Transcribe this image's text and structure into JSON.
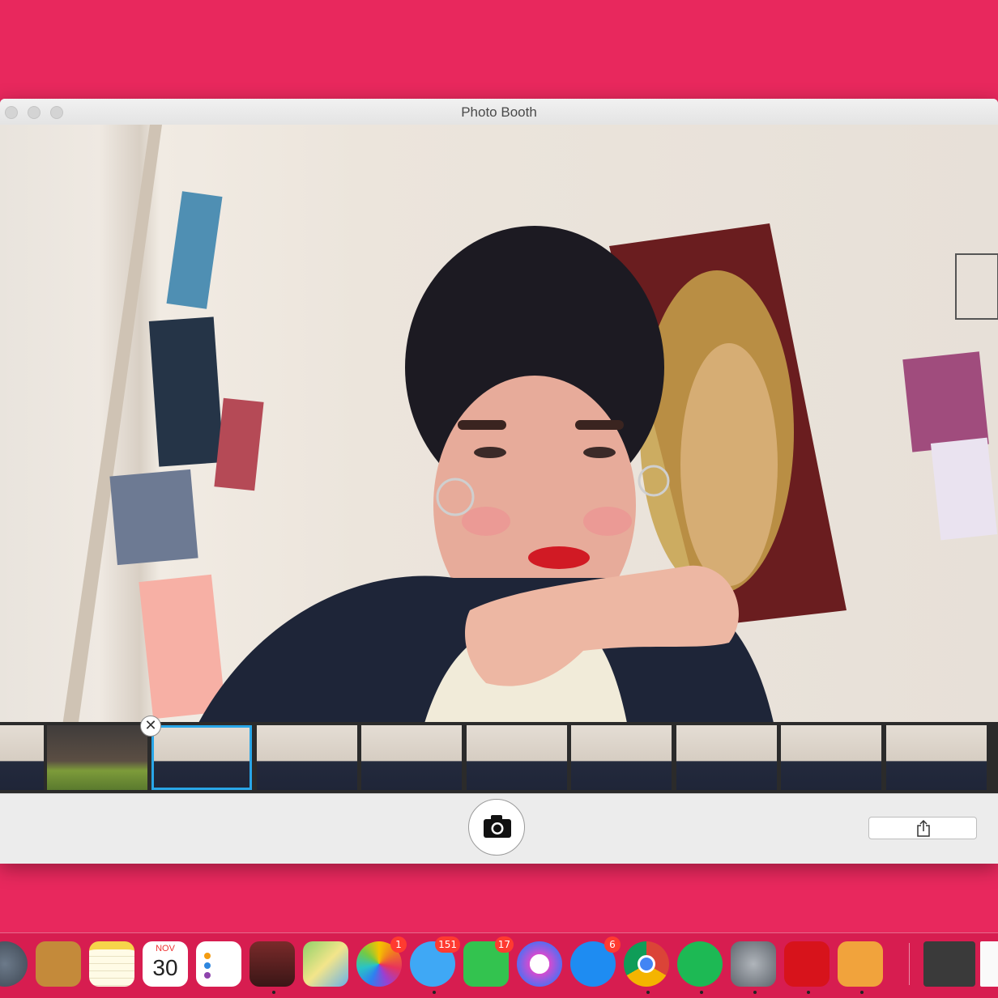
{
  "window": {
    "title": "Photo Booth"
  },
  "calendar": {
    "month": "NOV",
    "day": "30"
  },
  "dock": {
    "items": [
      {
        "name": "Launchpad",
        "icon": "rocket-icon"
      },
      {
        "name": "Contacts",
        "icon": "contacts-icon"
      },
      {
        "name": "Notes",
        "icon": "notes-icon"
      },
      {
        "name": "Calendar",
        "icon": "calendar-icon"
      },
      {
        "name": "Reminders",
        "icon": "reminders-icon"
      },
      {
        "name": "Photo Booth",
        "icon": "photo-booth-icon",
        "running": true
      },
      {
        "name": "Maps",
        "icon": "maps-icon"
      },
      {
        "name": "Photos",
        "icon": "photos-icon",
        "badge": "1"
      },
      {
        "name": "Messages",
        "icon": "messages-icon",
        "badge": "151",
        "running": true
      },
      {
        "name": "FaceTime",
        "icon": "facetime-icon",
        "badge": "17"
      },
      {
        "name": "iTunes",
        "icon": "itunes-icon"
      },
      {
        "name": "App Store",
        "icon": "app-store-icon",
        "badge": "6"
      },
      {
        "name": "Chrome",
        "icon": "chrome-icon",
        "running": true
      },
      {
        "name": "Spotify",
        "icon": "spotify-icon",
        "running": true
      },
      {
        "name": "System Preferences",
        "icon": "gear-icon",
        "running": true
      },
      {
        "name": "Adobe",
        "icon": "adobe-icon",
        "running": true
      },
      {
        "name": "Pages",
        "icon": "pages-icon",
        "running": true
      }
    ],
    "badges": {
      "photos": "1",
      "messages": "151",
      "facetime": "17",
      "app_store": "6"
    }
  },
  "colors": {
    "desktop": "#e8285d",
    "selection": "#29a6e8",
    "badge": "#ff3b30"
  },
  "buttons": {
    "shutter_icon": "camera-icon",
    "share_icon": "share-icon",
    "delete_icon": "close-icon"
  }
}
